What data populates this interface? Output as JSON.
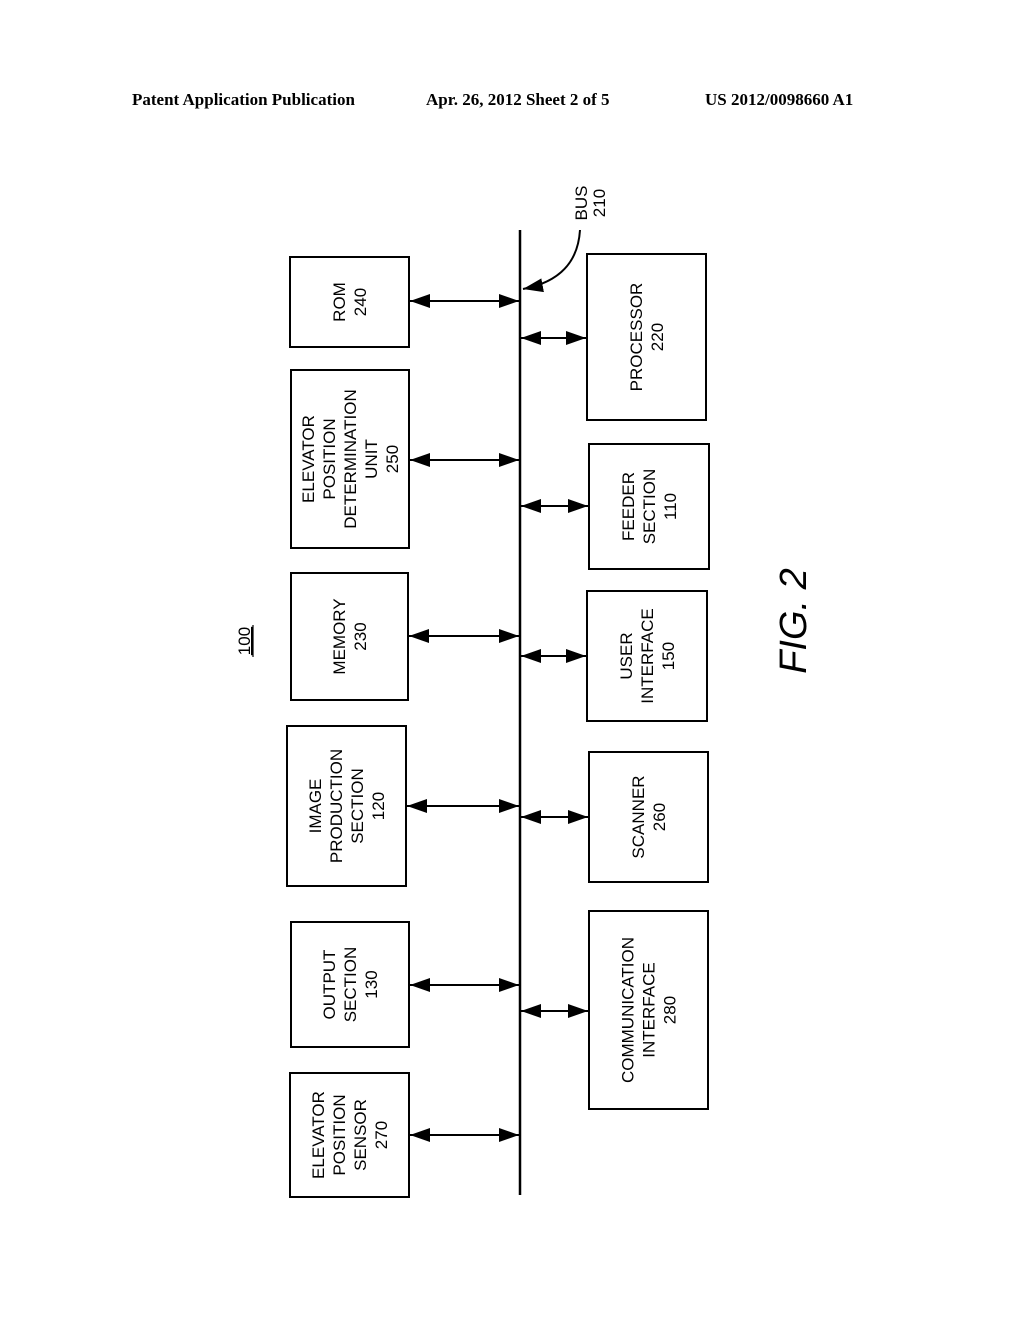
{
  "header": {
    "left": "Patent Application Publication",
    "middle": "Apr. 26, 2012  Sheet 2 of 5",
    "right": "US 2012/0098660 A1"
  },
  "diagram": {
    "system_ref": "100",
    "figure_label": "FIG. 2",
    "bus": {
      "label": "BUS",
      "ref": "210"
    },
    "left_blocks": [
      {
        "id": "rom",
        "lines": [
          "ROM",
          "240"
        ]
      },
      {
        "id": "elevator-position-determination-unit",
        "lines": [
          "ELEVATOR",
          "POSITION",
          "DETERMINATION",
          "UNIT",
          "250"
        ]
      },
      {
        "id": "memory",
        "lines": [
          "MEMORY",
          "230"
        ]
      },
      {
        "id": "image-production-section",
        "lines": [
          "IMAGE",
          "PRODUCTION",
          "SECTION",
          "120"
        ]
      },
      {
        "id": "output-section",
        "lines": [
          "OUTPUT",
          "SECTION",
          "130"
        ]
      },
      {
        "id": "elevator-position-sensor",
        "lines": [
          "ELEVATOR",
          "POSITION",
          "SENSOR",
          "270"
        ]
      }
    ],
    "right_blocks": [
      {
        "id": "processor",
        "lines": [
          "PROCESSOR",
          "220"
        ]
      },
      {
        "id": "feeder-section",
        "lines": [
          "FEEDER",
          "SECTION",
          "110"
        ]
      },
      {
        "id": "user-interface",
        "lines": [
          "USER",
          "INTERFACE",
          "150"
        ]
      },
      {
        "id": "scanner",
        "lines": [
          "SCANNER",
          "260"
        ]
      },
      {
        "id": "communication-interface",
        "lines": [
          "COMMUNICATION",
          "INTERFACE",
          "280"
        ]
      }
    ],
    "connections": "bidirectional"
  }
}
